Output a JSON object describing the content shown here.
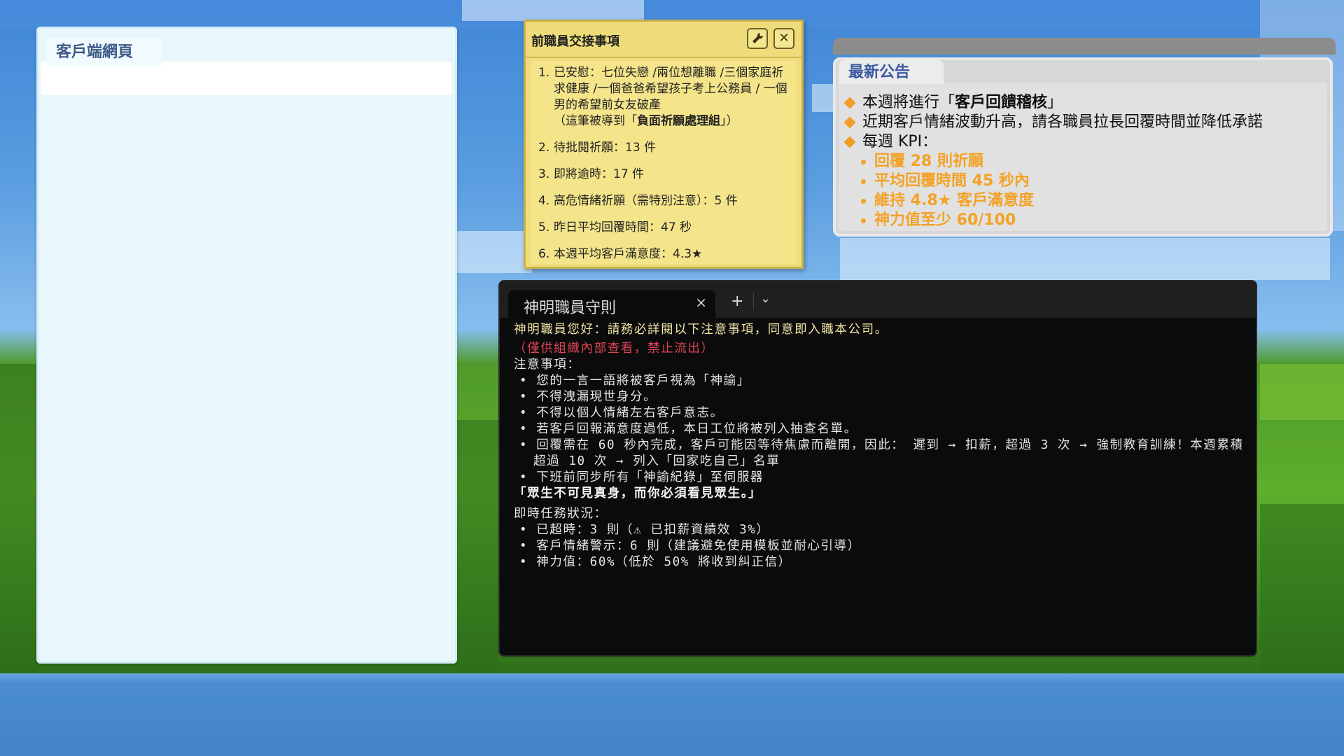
{
  "client": {
    "tab_title": "客戶端網頁"
  },
  "handover": {
    "title": "前職員交接事項",
    "tools_icon": "wrench-icon",
    "close_icon": "close-icon",
    "items": [
      {
        "num": "1.",
        "text": "已安慰：七位失戀 /兩位想離職 /三個家庭祈求健康 /一個爸爸希望孩子考上公務員 / 一個男的希望前女友破產",
        "note_prefix": "（這筆被導到「",
        "note_bold": "負面祈願處理組",
        "note_suffix": "」）"
      },
      {
        "num": "2.",
        "text": "待批閱祈願：13 件"
      },
      {
        "num": "3.",
        "text": "即將逾時：17 件"
      },
      {
        "num": "4.",
        "text": "高危情緒祈願（需特別注意）：5 件"
      },
      {
        "num": "5.",
        "text": "昨日平均回覆時間：47 秒"
      },
      {
        "num": "6.",
        "text": "本週平均客戶滿意度：4.3★"
      }
    ]
  },
  "announcement": {
    "tab_title": "最新公告",
    "line1_prefix": "本週將進行「",
    "line1_bold": "客戶回饋稽核",
    "line1_suffix": "」",
    "line2": "近期客戶情緒波動升高，請各職員拉長回覆時間並降低承諾",
    "line3": "每週 KPI：",
    "kpis": [
      "回覆 28 則祈願",
      "平均回覆時間 45 秒內",
      "維持 4.8★ 客戶滿意度",
      "神力值至少 60/100"
    ],
    "accent_color": "#f3a226"
  },
  "terminal": {
    "tab_title": "神明職員守則",
    "tab_close": "×",
    "plus": "+",
    "dropdown": "⌄",
    "greeting": "神明職員您好：請務必詳閱以下注意事項，同意即入職本公司。",
    "warning": "（僅供組織內部查看，禁止流出）",
    "notes_header": "注意事項：",
    "notes": [
      "您的一言一語將被客戶視為「神諭」",
      "不得洩漏現世身分。",
      "不得以個人情緒左右客戶意志。",
      "若客戶回報滿意度過低，本日工位將被列入抽查名單。",
      "回覆需在 60 秒內完成，客戶可能因等待焦慮而離開，因此： 遲到 → 扣薪，超過 3 次 → 強制教育訓練！本週累積超過 10 次 → 列入「回家吃自己」名單",
      "下班前同步所有「神諭紀錄」至伺服器"
    ],
    "motto": "「眾生不可見真身，而你必須看見眾生。」",
    "status_header": "即時任務狀況：",
    "status": [
      "已超時：3 則（⚠ 已扣薪資績效 3%）",
      "客戶情緒警示：6 則（建議避免使用模板並耐心引導）",
      "神力值：60%（低於 50% 將收到糾正信）"
    ]
  }
}
